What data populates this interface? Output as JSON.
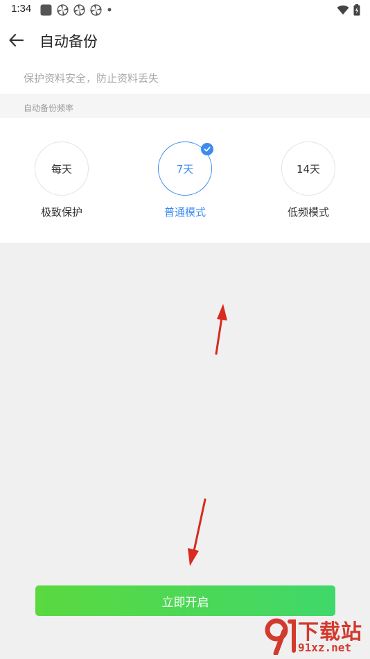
{
  "status_bar": {
    "time": "1:34",
    "left_icons": [
      "app-square-icon",
      "pinwheel-icon",
      "pinwheel-icon",
      "pinwheel-icon",
      "dot-icon"
    ],
    "right_icons": [
      "wifi-icon",
      "battery-charging-icon"
    ]
  },
  "header": {
    "back_icon": "arrow-left-icon",
    "title": "自动备份"
  },
  "description": "保护资料安全，防止资料丢失",
  "section_label": "自动备份频率",
  "options": [
    {
      "circle_label": "每天",
      "name": "极致保护",
      "selected": false
    },
    {
      "circle_label": "7天",
      "name": "普通模式",
      "selected": true
    },
    {
      "circle_label": "14天",
      "name": "低频模式",
      "selected": false
    }
  ],
  "start_button_label": "立即开启",
  "colors": {
    "accent_blue": "#3d8bee",
    "button_green_start": "#5ad93f",
    "button_green_end": "#40d86a",
    "annotation_red": "#d82a1e",
    "background_gray": "#f0f0f0"
  },
  "watermark": {
    "title": "下载站",
    "domain": "91xz.net"
  }
}
